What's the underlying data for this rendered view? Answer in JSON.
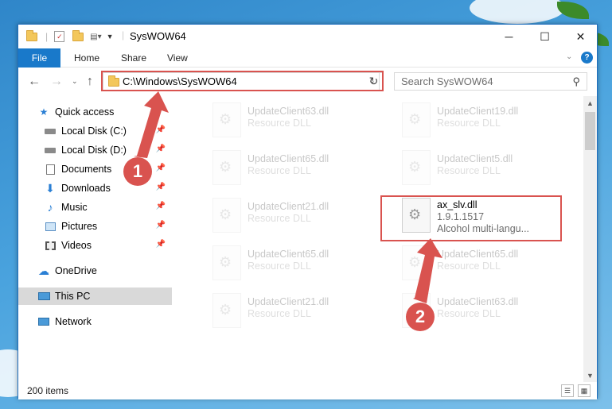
{
  "window": {
    "title": "SysWOW64"
  },
  "ribbon": {
    "tabs": [
      "File",
      "Home",
      "Share",
      "View"
    ]
  },
  "address": {
    "path": "C:\\Windows\\SysWOW64"
  },
  "search": {
    "placeholder": "Search SysWOW64"
  },
  "sidebar": {
    "items": [
      {
        "label": "Quick access"
      },
      {
        "label": "Local Disk (C:)"
      },
      {
        "label": "Local Disk (D:)"
      },
      {
        "label": "Documents"
      },
      {
        "label": "Downloads"
      },
      {
        "label": "Music"
      },
      {
        "label": "Pictures"
      },
      {
        "label": "Videos"
      },
      {
        "label": "OneDrive"
      },
      {
        "label": "This PC"
      },
      {
        "label": "Network"
      }
    ]
  },
  "files": [
    {
      "name": "UpdateClient63.dll",
      "sub": "Resource DLL"
    },
    {
      "name": "UpdateClient19.dll",
      "sub": "Resource DLL"
    },
    {
      "name": "UpdateClient65.dll",
      "sub": "Resource DLL"
    },
    {
      "name": "UpdateClient5.dll",
      "sub": "Resource DLL"
    },
    {
      "name": "UpdateClient21.dll",
      "sub": "Resource DLL"
    },
    {
      "name": "ax_slv.dll",
      "version": "1.9.1.1517",
      "desc": "Alcohol multi-langu..."
    },
    {
      "name": "UpdateClient65.dll",
      "sub": "Resource DLL"
    },
    {
      "name": "UpdateClient65.dll",
      "sub": "Resource DLL"
    },
    {
      "name": "UpdateClient21.dll",
      "sub": "Resource DLL"
    },
    {
      "name": "UpdateClient63.dll",
      "sub": "Resource DLL"
    }
  ],
  "status": {
    "item_count": "200 items"
  },
  "annotations": {
    "callout1": "1",
    "callout2": "2",
    "color": "#d9534f"
  },
  "icons": [
    "folder-icon",
    "properties-icon",
    "new-folder-icon",
    "back-arrow-icon",
    "forward-arrow-icon",
    "up-arrow-icon",
    "refresh-icon",
    "search-icon",
    "star-icon",
    "drive-icon",
    "pin-icon",
    "dll-gear-icon",
    "help-icon"
  ]
}
